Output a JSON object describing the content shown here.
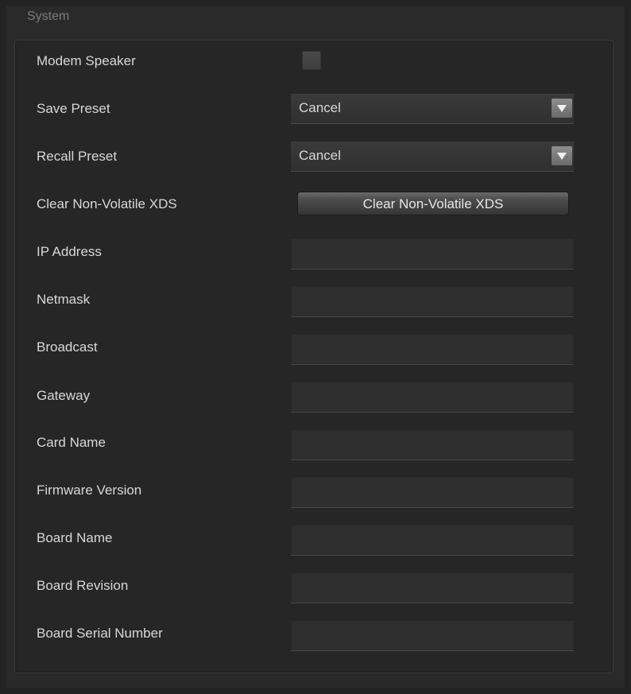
{
  "group": {
    "title": "System"
  },
  "rows": {
    "modem_speaker": {
      "label": "Modem Speaker",
      "checked": false
    },
    "save_preset": {
      "label": "Save Preset",
      "value": "Cancel"
    },
    "recall_preset": {
      "label": "Recall Preset",
      "value": "Cancel"
    },
    "clear_xds": {
      "label": "Clear Non-Volatile XDS",
      "button_label": "Clear Non-Volatile XDS"
    },
    "ip_address": {
      "label": "IP Address",
      "value": ""
    },
    "netmask": {
      "label": "Netmask",
      "value": ""
    },
    "broadcast": {
      "label": "Broadcast",
      "value": ""
    },
    "gateway": {
      "label": "Gateway",
      "value": ""
    },
    "card_name": {
      "label": "Card Name",
      "value": ""
    },
    "firmware_version": {
      "label": "Firmware Version",
      "value": ""
    },
    "board_name": {
      "label": "Board Name",
      "value": ""
    },
    "board_revision": {
      "label": "Board Revision",
      "value": ""
    },
    "board_serial_number": {
      "label": "Board Serial Number",
      "value": ""
    }
  },
  "colors": {
    "background": "#232323",
    "text": "#d8d8d8",
    "group_title": "#7c7c7c"
  }
}
